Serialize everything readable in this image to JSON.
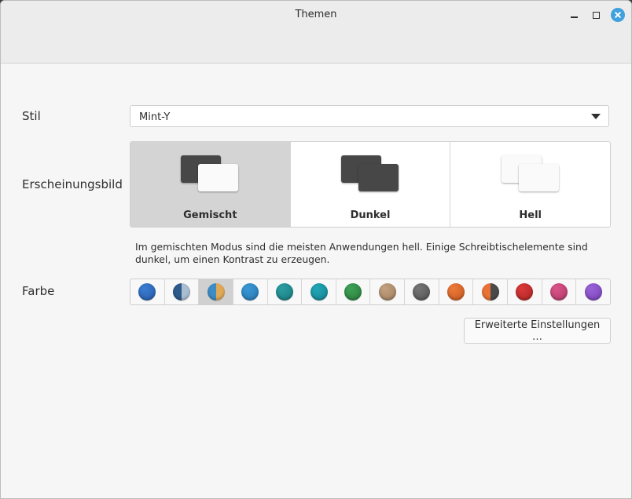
{
  "window": {
    "title": "Themen",
    "controls": [
      "minimize-icon",
      "maximize-icon",
      "close-icon"
    ],
    "accent": "#3fa1dd"
  },
  "style": {
    "label": "Stil",
    "selected": "Mint-Y"
  },
  "appearance": {
    "label": "Erscheinungsbild",
    "options": [
      {
        "label": "Gemischt",
        "selected": true,
        "back": "dark",
        "front": "light"
      },
      {
        "label": "Dunkel",
        "selected": false,
        "back": "dark",
        "front": "dark"
      },
      {
        "label": "Hell",
        "selected": false,
        "back": "light",
        "front": "light"
      }
    ],
    "description": "Im gemischten Modus sind die meisten Anwendungen hell. Einige Schreibtischelemente sind dunkel, um einen Kontrast zu erzeugen."
  },
  "color": {
    "label": "Farbe",
    "swatches": [
      {
        "name": "blue",
        "colors": [
          "#3b7dd0",
          "#2a5fae"
        ],
        "split": false,
        "selected": false
      },
      {
        "name": "blue-grey-split",
        "colors": [
          "#2d5a8a",
          "#a9bdd0"
        ],
        "split": true,
        "selected": false
      },
      {
        "name": "aqua-sand-split",
        "colors": [
          "#3d8cc6",
          "#e0a957"
        ],
        "split": true,
        "selected": true
      },
      {
        "name": "light-blue",
        "colors": [
          "#3a97d4",
          "#2a7cb8"
        ],
        "split": false,
        "selected": false
      },
      {
        "name": "teal",
        "colors": [
          "#2b9ea2",
          "#1c7f84"
        ],
        "split": false,
        "selected": false
      },
      {
        "name": "cyan",
        "colors": [
          "#22a7b6",
          "#168896"
        ],
        "split": false,
        "selected": false
      },
      {
        "name": "green",
        "colors": [
          "#3fa255",
          "#2b8040"
        ],
        "split": false,
        "selected": false
      },
      {
        "name": "sand",
        "colors": [
          "#c3a180",
          "#a48363"
        ],
        "split": false,
        "selected": false
      },
      {
        "name": "grey",
        "colors": [
          "#757575",
          "#585858"
        ],
        "split": false,
        "selected": false
      },
      {
        "name": "orange",
        "colors": [
          "#ec7a3a",
          "#cc5c22"
        ],
        "split": false,
        "selected": false
      },
      {
        "name": "orange-dark-split",
        "colors": [
          "#e97336",
          "#4a4a4a"
        ],
        "split": true,
        "selected": false
      },
      {
        "name": "red",
        "colors": [
          "#d93a3a",
          "#b42626"
        ],
        "split": false,
        "selected": false
      },
      {
        "name": "pink",
        "colors": [
          "#d9558a",
          "#b93b6d"
        ],
        "split": false,
        "selected": false
      },
      {
        "name": "purple",
        "colors": [
          "#9a63d8",
          "#7c46bb"
        ],
        "split": false,
        "selected": false
      }
    ]
  },
  "advanced_button": "Erweiterte Einstellungen …"
}
